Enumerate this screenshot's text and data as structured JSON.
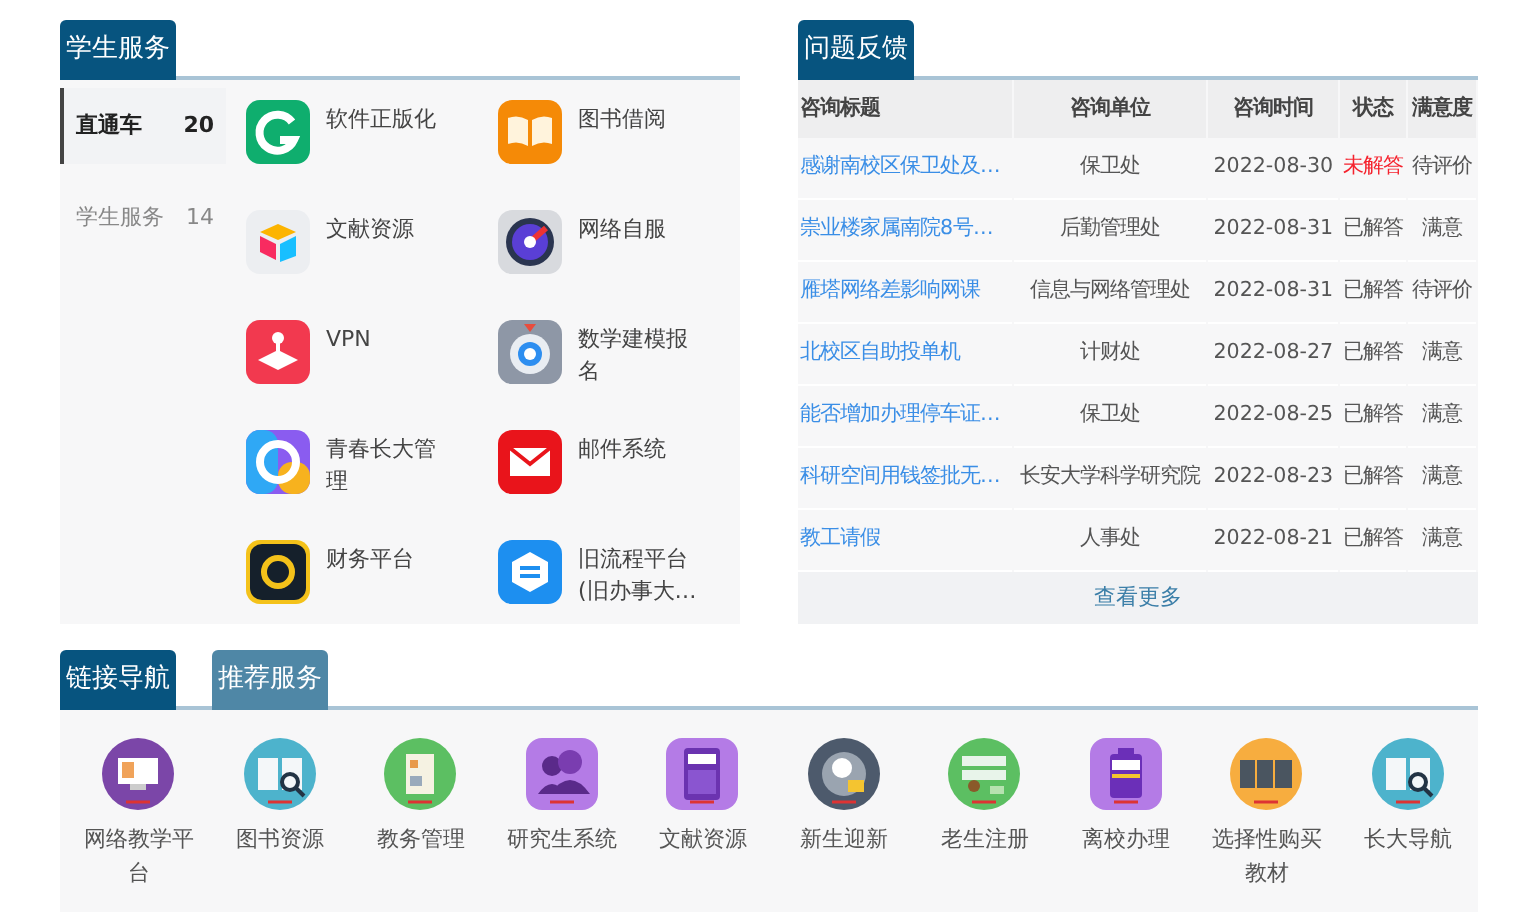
{
  "student_services": {
    "tab": "学生服务",
    "sidebar": [
      {
        "label": "直通车",
        "count": "20",
        "selected": true
      },
      {
        "label": "学生服务",
        "count": "14",
        "selected": false
      }
    ],
    "apps": [
      {
        "label": "软件正版化"
      },
      {
        "label": "图书借阅"
      },
      {
        "label": "文献资源"
      },
      {
        "label": "网络自服"
      },
      {
        "label": "VPN"
      },
      {
        "label": "数学建模报名"
      },
      {
        "label": "青春长大管理"
      },
      {
        "label": "邮件系统"
      },
      {
        "label": "财务平台"
      },
      {
        "label": "旧流程平台(旧办事大…"
      }
    ]
  },
  "feedback": {
    "tab": "问题反馈",
    "columns": [
      "咨询标题",
      "咨询单位",
      "咨询时间",
      "状态",
      "满意度"
    ],
    "rows": [
      {
        "title": "感谢南校区保卫处及…",
        "unit": "保卫处",
        "date": "2022-08-30",
        "status": "未解答",
        "answered": false,
        "rating": "待评价"
      },
      {
        "title": "崇业楼家属南院8号…",
        "unit": "后勤管理处",
        "date": "2022-08-31",
        "status": "已解答",
        "answered": true,
        "rating": "满意"
      },
      {
        "title": "雁塔网络差影响网课",
        "unit": "信息与网络管理处",
        "date": "2022-08-31",
        "status": "已解答",
        "answered": true,
        "rating": "待评价"
      },
      {
        "title": "北校区自助投单机",
        "unit": "计财处",
        "date": "2022-08-27",
        "status": "已解答",
        "answered": true,
        "rating": "满意"
      },
      {
        "title": "能否增加办理停车证…",
        "unit": "保卫处",
        "date": "2022-08-25",
        "status": "已解答",
        "answered": true,
        "rating": "满意"
      },
      {
        "title": "科研空间用钱签批无…",
        "unit": "长安大学科学研究院",
        "date": "2022-08-23",
        "status": "已解答",
        "answered": true,
        "rating": "满意"
      },
      {
        "title": "教工请假",
        "unit": "人事处",
        "date": "2022-08-21",
        "status": "已解答",
        "answered": true,
        "rating": "满意"
      }
    ],
    "more": "查看更多"
  },
  "links": {
    "tabs": [
      {
        "label": "链接导航",
        "selected": true
      },
      {
        "label": "推荐服务",
        "selected": false
      }
    ],
    "items": [
      {
        "label": "网络教学平台"
      },
      {
        "label": "图书资源"
      },
      {
        "label": "教务管理"
      },
      {
        "label": "研究生系统"
      },
      {
        "label": "文献资源"
      },
      {
        "label": "新生迎新"
      },
      {
        "label": "老生注册"
      },
      {
        "label": "离校办理"
      },
      {
        "label": "选择性购买教材"
      },
      {
        "label": "长大导航"
      }
    ]
  }
}
